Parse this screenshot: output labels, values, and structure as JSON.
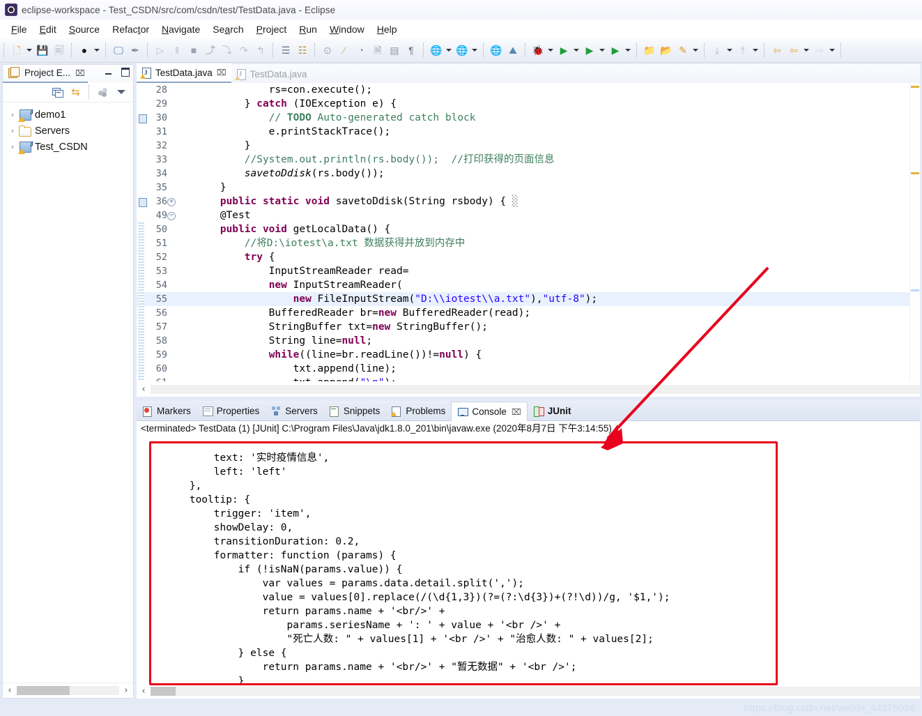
{
  "window": {
    "title": "eclipse-workspace - Test_CSDN/src/com/csdn/test/TestData.java - Eclipse",
    "app_icon": "eclipse-icon"
  },
  "menubar": {
    "items": [
      {
        "label": "File",
        "mnemonic": "F"
      },
      {
        "label": "Edit",
        "mnemonic": "E"
      },
      {
        "label": "Source",
        "mnemonic": "S"
      },
      {
        "label": "Refactor",
        "mnemonic": "t"
      },
      {
        "label": "Navigate",
        "mnemonic": "N"
      },
      {
        "label": "Search",
        "mnemonic": "a"
      },
      {
        "label": "Project",
        "mnemonic": "P"
      },
      {
        "label": "Run",
        "mnemonic": "R"
      },
      {
        "label": "Window",
        "mnemonic": "W"
      },
      {
        "label": "Help",
        "mnemonic": "H"
      }
    ]
  },
  "toolbar": {
    "groups": [
      {
        "buttons": [
          {
            "name": "new-wizard-button",
            "glyph": "🗋",
            "color": "#e8a33d",
            "dropdown": true
          },
          {
            "name": "save-button",
            "glyph": "💾",
            "color": "#a8b3c4",
            "dropdown": false
          },
          {
            "name": "save-all-button",
            "glyph": "🗐",
            "color": "#a8b3c4",
            "dropdown": false
          }
        ]
      },
      {
        "buttons": [
          {
            "name": "open-type-button",
            "glyph": "●",
            "color": "#1c1c1c",
            "dropdown": true
          }
        ]
      },
      {
        "buttons": [
          {
            "name": "new-java-console-button",
            "glyph": "🖵",
            "color": "#3a6fb5",
            "dropdown": false
          },
          {
            "name": "toggle-mark-occurrences-button",
            "glyph": "✒",
            "color": "#7c8796",
            "dropdown": false
          }
        ]
      },
      {
        "buttons": [
          {
            "name": "debug-resume-button",
            "glyph": "▷",
            "color": "#b9c2ce",
            "dropdown": false
          },
          {
            "name": "debug-suspend-button",
            "glyph": "‖",
            "color": "#b9c2ce",
            "dropdown": false
          },
          {
            "name": "debug-terminate-button",
            "glyph": "■",
            "color": "#9aa4b2",
            "dropdown": false
          },
          {
            "name": "debug-disconnect-button",
            "glyph": "⤴",
            "color": "#9aa4b2",
            "dropdown": false
          },
          {
            "name": "step-into-button",
            "glyph": "⤵",
            "color": "#b9c2ce",
            "dropdown": false
          },
          {
            "name": "step-over-button",
            "glyph": "↷",
            "color": "#b9c2ce",
            "dropdown": false
          },
          {
            "name": "step-return-button",
            "glyph": "↰",
            "color": "#b9c2ce",
            "dropdown": false
          }
        ]
      },
      {
        "buttons": [
          {
            "name": "next-annotation-button",
            "glyph": "☰",
            "color": "#6d7684",
            "dropdown": false
          },
          {
            "name": "previous-annotation-button",
            "glyph": "☷",
            "color": "#c58c2a",
            "dropdown": false
          }
        ]
      },
      {
        "buttons": [
          {
            "name": "toggle-breakpoint-button",
            "glyph": "⊙",
            "color": "#9aa4b2",
            "dropdown": false
          },
          {
            "name": "skip-all-breakpoints-button",
            "glyph": "∕",
            "color": "#c7b07a",
            "dropdown": false
          },
          {
            "name": "toggle-watchpoint-button",
            "glyph": "◔",
            "color": "#8d97a6",
            "dropdown": false
          },
          {
            "name": "open-task-button",
            "glyph": "🗎",
            "color": "#8d97a6",
            "dropdown": false
          },
          {
            "name": "show-whitespace-button",
            "glyph": "▤",
            "color": "#8d97a6",
            "dropdown": false
          },
          {
            "name": "paragraph-mark-button",
            "glyph": "¶",
            "color": "#6d7684",
            "dropdown": false
          }
        ]
      },
      {
        "buttons": [
          {
            "name": "open-web-browser-button",
            "glyph": "🌐",
            "color": "#3f8fd0",
            "dropdown": true
          },
          {
            "name": "new-dynamic-web-project-button",
            "glyph": "🌐",
            "color": "#2a6db5",
            "dropdown": true
          }
        ]
      },
      {
        "buttons": [
          {
            "name": "web-preview-button",
            "glyph": "🌐",
            "color": "#3f8fd0",
            "dropdown": false
          },
          {
            "name": "deploy-button",
            "glyph": "⛰",
            "color": "#5b86b8",
            "dropdown": false
          }
        ]
      },
      {
        "buttons": [
          {
            "name": "debug-button",
            "glyph": "🐞",
            "color": "#6f7a88",
            "dropdown": true
          },
          {
            "name": "run-button",
            "glyph": "▶",
            "color": "#1f9d3a",
            "dropdown": true
          },
          {
            "name": "run-as-server-button",
            "glyph": "▶",
            "color": "#1f9d3a",
            "dropdown": true
          },
          {
            "name": "run-coverage-button",
            "glyph": "▶",
            "color": "#1f9d3a",
            "dropdown": true
          }
        ]
      },
      {
        "buttons": [
          {
            "name": "open-package-button",
            "glyph": "📁",
            "color": "#e0a846",
            "dropdown": false
          },
          {
            "name": "open-resource-button",
            "glyph": "📂",
            "color": "#e0a846",
            "dropdown": false
          },
          {
            "name": "new-annotation-button",
            "glyph": "✎",
            "color": "#d89b2b",
            "dropdown": true
          }
        ]
      },
      {
        "buttons": [
          {
            "name": "previous-edit-button",
            "glyph": "⤓",
            "color": "#b2bccb",
            "dropdown": true
          },
          {
            "name": "next-edit-button",
            "glyph": "⤒",
            "color": "#b2bccb",
            "dropdown": true
          }
        ]
      },
      {
        "buttons": [
          {
            "name": "back-button",
            "glyph": "⇦",
            "color": "#e0a846",
            "dropdown": false
          },
          {
            "name": "forward-button",
            "glyph": "⇦",
            "color": "#e0a846",
            "dropdown": true
          },
          {
            "name": "forward-disabled-button",
            "glyph": "⇨",
            "color": "#d5dae3",
            "dropdown": true
          }
        ]
      }
    ]
  },
  "sidebar": {
    "tab": {
      "label": "Project E...",
      "icon": "project-explorer-icon",
      "close": "⌧"
    },
    "window_buttons": [
      {
        "name": "minimize-view-button",
        "kind": "min"
      },
      {
        "name": "maximize-view-button",
        "kind": "max"
      }
    ],
    "toolbar": [
      {
        "name": "collapse-all-button",
        "icon": "collapse-all-icon"
      },
      {
        "name": "link-with-editor-button",
        "icon": "link-editor-icon"
      },
      {
        "name": "focus-on-active-task-button",
        "icon": "focus-task-icon"
      },
      {
        "name": "view-menu-button",
        "icon": "view-menu-icon"
      }
    ],
    "tree": [
      {
        "label": "demo1",
        "icon": "java-project-icon",
        "expanded": false
      },
      {
        "label": "Servers",
        "icon": "folder-icon",
        "expanded": false
      },
      {
        "label": "Test_CSDN",
        "icon": "java-project-icon",
        "expanded": false
      }
    ],
    "hscroll": {
      "left_arrow": "‹",
      "right_arrow": "›",
      "thumb_pct": 52
    }
  },
  "editor": {
    "tabs": [
      {
        "label": "TestData.java",
        "active": true,
        "closable": true,
        "icon": "java-file-icon"
      },
      {
        "label": "TestData.java",
        "active": false,
        "closable": false,
        "icon": "java-file-icon"
      }
    ],
    "highlight_line": 55,
    "lines": [
      {
        "n": "28",
        "marker": "",
        "fold": "",
        "parts": [
          {
            "t": "                ",
            "c": "ctext"
          },
          {
            "t": "rs=con.execute();",
            "c": "ctext"
          }
        ]
      },
      {
        "n": "29",
        "marker": "",
        "fold": "",
        "parts": [
          {
            "t": "            } ",
            "c": "ctext"
          },
          {
            "t": "catch",
            "c": "kw"
          },
          {
            "t": " (IOException e) {",
            "c": "ctext"
          }
        ]
      },
      {
        "n": "30",
        "marker": "todo",
        "fold": "",
        "parts": [
          {
            "t": "                ",
            "c": "ctext"
          },
          {
            "t": "// ",
            "c": "cm"
          },
          {
            "t": "TODO",
            "c": "td"
          },
          {
            "t": " Auto-generated catch block",
            "c": "cm"
          }
        ]
      },
      {
        "n": "31",
        "marker": "",
        "fold": "",
        "parts": [
          {
            "t": "                e.printStackTrace();",
            "c": "ctext"
          }
        ]
      },
      {
        "n": "32",
        "marker": "",
        "fold": "",
        "parts": [
          {
            "t": "            }",
            "c": "ctext"
          }
        ]
      },
      {
        "n": "33",
        "marker": "",
        "fold": "",
        "parts": [
          {
            "t": "            ",
            "c": "ctext"
          },
          {
            "t": "//System.out.println(rs.body());  //打印获得的页面信息",
            "c": "cm"
          }
        ]
      },
      {
        "n": "34",
        "marker": "",
        "fold": "",
        "parts": [
          {
            "t": "            ",
            "c": "ctext"
          },
          {
            "t": "savetoDdisk",
            "c": "it"
          },
          {
            "t": "(rs.body());",
            "c": "ctext"
          }
        ]
      },
      {
        "n": "35",
        "marker": "",
        "fold": "",
        "parts": [
          {
            "t": "        }",
            "c": "ctext"
          }
        ]
      },
      {
        "n": "36",
        "marker": "todo",
        "fold": "plus",
        "parts": [
          {
            "t": "        ",
            "c": "ctext"
          },
          {
            "t": "public static void",
            "c": "kw"
          },
          {
            "t": " savetoDdisk(String rsbody) { ",
            "c": "ctext"
          },
          {
            "t": "░",
            "c": "ann"
          }
        ]
      },
      {
        "n": "49",
        "marker": "",
        "fold": "minus",
        "parts": [
          {
            "t": "        @Test",
            "c": "ctext"
          }
        ]
      },
      {
        "n": "50",
        "marker": "",
        "fold": "bar",
        "parts": [
          {
            "t": "        ",
            "c": "ctext"
          },
          {
            "t": "public void",
            "c": "kw"
          },
          {
            "t": " getLocalData() {",
            "c": "ctext"
          }
        ]
      },
      {
        "n": "51",
        "marker": "",
        "fold": "bar",
        "parts": [
          {
            "t": "            ",
            "c": "ctext"
          },
          {
            "t": "//将D:\\iotest\\a.txt 数据获得并放到内存中",
            "c": "cm"
          }
        ]
      },
      {
        "n": "52",
        "marker": "",
        "fold": "bar",
        "parts": [
          {
            "t": "            ",
            "c": "ctext"
          },
          {
            "t": "try",
            "c": "kw"
          },
          {
            "t": " {",
            "c": "ctext"
          }
        ]
      },
      {
        "n": "53",
        "marker": "",
        "fold": "bar",
        "parts": [
          {
            "t": "                InputStreamReader read=",
            "c": "ctext"
          }
        ]
      },
      {
        "n": "54",
        "marker": "",
        "fold": "bar",
        "parts": [
          {
            "t": "                ",
            "c": "ctext"
          },
          {
            "t": "new",
            "c": "kw"
          },
          {
            "t": " InputStreamReader(",
            "c": "ctext"
          }
        ]
      },
      {
        "n": "55",
        "marker": "",
        "fold": "bar",
        "parts": [
          {
            "t": "                    ",
            "c": "ctext"
          },
          {
            "t": "new",
            "c": "kw"
          },
          {
            "t": " FileInputStream(",
            "c": "ctext"
          },
          {
            "t": "\"D:\\\\iotest\\\\a.txt\"",
            "c": "str"
          },
          {
            "t": "),",
            "c": "ctext"
          },
          {
            "t": "\"utf-8\"",
            "c": "str"
          },
          {
            "t": ");",
            "c": "ctext"
          }
        ]
      },
      {
        "n": "56",
        "marker": "",
        "fold": "bar",
        "parts": [
          {
            "t": "                BufferedReader br=",
            "c": "ctext"
          },
          {
            "t": "new",
            "c": "kw"
          },
          {
            "t": " BufferedReader(read);",
            "c": "ctext"
          }
        ]
      },
      {
        "n": "57",
        "marker": "",
        "fold": "bar",
        "parts": [
          {
            "t": "                StringBuffer txt=",
            "c": "ctext"
          },
          {
            "t": "new",
            "c": "kw"
          },
          {
            "t": " StringBuffer();",
            "c": "ctext"
          }
        ]
      },
      {
        "n": "58",
        "marker": "",
        "fold": "bar",
        "parts": [
          {
            "t": "                String line=",
            "c": "ctext"
          },
          {
            "t": "null",
            "c": "kw"
          },
          {
            "t": ";",
            "c": "ctext"
          }
        ]
      },
      {
        "n": "59",
        "marker": "",
        "fold": "bar",
        "parts": [
          {
            "t": "                ",
            "c": "ctext"
          },
          {
            "t": "while",
            "c": "kw"
          },
          {
            "t": "((line=br.readLine())!=",
            "c": "ctext"
          },
          {
            "t": "null",
            "c": "kw"
          },
          {
            "t": ") {",
            "c": "ctext"
          }
        ]
      },
      {
        "n": "60",
        "marker": "",
        "fold": "bar",
        "parts": [
          {
            "t": "                    txt.append(line);",
            "c": "ctext"
          }
        ]
      },
      {
        "n": "61",
        "marker": "",
        "fold": "bar",
        "parts": [
          {
            "t": "                    txt.append(",
            "c": "ctext"
          },
          {
            "t": "\"\\n\"",
            "c": "str"
          },
          {
            "t": ");",
            "c": "ctext"
          }
        ]
      }
    ],
    "hscroll": {
      "left_arrow": "‹"
    }
  },
  "bottom_panel": {
    "tabs": [
      {
        "label": "Markers",
        "icon": "markers-icon",
        "active": false,
        "closable": false,
        "bold": false
      },
      {
        "label": "Properties",
        "icon": "properties-icon",
        "active": false,
        "closable": false,
        "bold": false
      },
      {
        "label": "Servers",
        "icon": "servers-icon",
        "active": false,
        "closable": false,
        "bold": false
      },
      {
        "label": "Snippets",
        "icon": "snippets-icon",
        "active": false,
        "closable": false,
        "bold": false
      },
      {
        "label": "Problems",
        "icon": "problems-icon",
        "active": false,
        "closable": false,
        "bold": false
      },
      {
        "label": "Console",
        "icon": "console-icon",
        "active": true,
        "closable": true,
        "bold": false
      },
      {
        "label": "JUnit",
        "icon": "junit-icon",
        "active": false,
        "closable": false,
        "bold": true
      }
    ],
    "console_header": "<terminated> TestData (1) [JUnit] C:\\Program Files\\Java\\jdk1.8.0_201\\bin\\javaw.exe (2020年8月7日 下午3:14:55)",
    "console_lines": [
      "            text: '实时疫情信息',",
      "            left: 'left'",
      "        },",
      "        tooltip: {",
      "            trigger: 'item',",
      "            showDelay: 0,",
      "            transitionDuration: 0.2,",
      "            formatter: function (params) {",
      "                if (!isNaN(params.value)) {",
      "                    var values = params.data.detail.split(',');",
      "                    value = values[0].replace(/(\\d{1,3})(?=(?:\\d{3})+(?!\\d))/g, '$1,');",
      "                    return params.name + '<br/>' +",
      "                        params.seriesName + ': ' + value + '<br />' +",
      "                        \"死亡人数: \" + values[1] + '<br />' + \"治愈人数: \" + values[2];",
      "                } else {",
      "                    return params.name + '<br/>' + \"暂无数据\" + '<br />';",
      "                }"
    ],
    "hscroll": {
      "left_arrow": "‹"
    }
  },
  "annotations": {
    "red_box": {
      "name": "highlight-box",
      "color": "#e8001c"
    },
    "red_arrow": {
      "name": "pointer-arrow",
      "color": "#e8001c"
    }
  },
  "watermark": {
    "text": "https://blog.csdn.net/weixin_44275036"
  }
}
